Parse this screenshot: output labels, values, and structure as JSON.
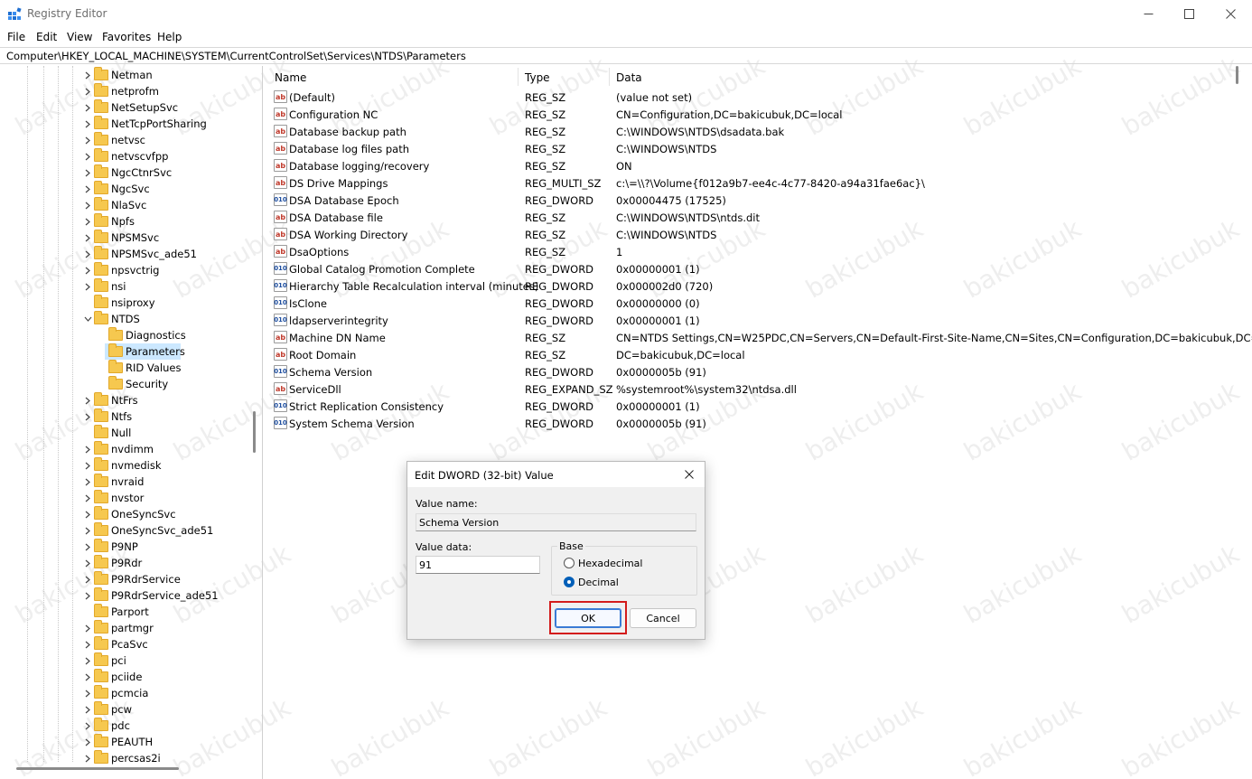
{
  "window": {
    "title": "Registry Editor"
  },
  "menu": [
    "File",
    "Edit",
    "View",
    "Favorites",
    "Help"
  ],
  "address": "Computer\\HKEY_LOCAL_MACHINE\\SYSTEM\\CurrentControlSet\\Services\\NTDS\\Parameters",
  "tree": {
    "items": [
      {
        "label": "Netman",
        "expandable": true
      },
      {
        "label": "netprofm",
        "expandable": true
      },
      {
        "label": "NetSetupSvc",
        "expandable": true
      },
      {
        "label": "NetTcpPortSharing",
        "expandable": true
      },
      {
        "label": "netvsc",
        "expandable": true
      },
      {
        "label": "netvscvfpp",
        "expandable": true
      },
      {
        "label": "NgcCtnrSvc",
        "expandable": true
      },
      {
        "label": "NgcSvc",
        "expandable": true
      },
      {
        "label": "NlaSvc",
        "expandable": true
      },
      {
        "label": "Npfs",
        "expandable": true
      },
      {
        "label": "NPSMSvc",
        "expandable": true
      },
      {
        "label": "NPSMSvc_ade51",
        "expandable": true
      },
      {
        "label": "npsvctrig",
        "expandable": true
      },
      {
        "label": "nsi",
        "expandable": true
      },
      {
        "label": "nsiproxy",
        "expandable": false
      },
      {
        "label": "NTDS",
        "expandable": true,
        "expanded": true
      },
      {
        "label": "Diagnostics",
        "child": true
      },
      {
        "label": "Parameters",
        "child": true,
        "selected": true
      },
      {
        "label": "RID Values",
        "child": true
      },
      {
        "label": "Security",
        "child": true
      },
      {
        "label": "NtFrs",
        "expandable": true
      },
      {
        "label": "Ntfs",
        "expandable": true
      },
      {
        "label": "Null",
        "expandable": false
      },
      {
        "label": "nvdimm",
        "expandable": true
      },
      {
        "label": "nvmedisk",
        "expandable": true
      },
      {
        "label": "nvraid",
        "expandable": true
      },
      {
        "label": "nvstor",
        "expandable": true
      },
      {
        "label": "OneSyncSvc",
        "expandable": true
      },
      {
        "label": "OneSyncSvc_ade51",
        "expandable": true
      },
      {
        "label": "P9NP",
        "expandable": true
      },
      {
        "label": "P9Rdr",
        "expandable": true
      },
      {
        "label": "P9RdrService",
        "expandable": true
      },
      {
        "label": "P9RdrService_ade51",
        "expandable": true
      },
      {
        "label": "Parport",
        "expandable": false
      },
      {
        "label": "partmgr",
        "expandable": true
      },
      {
        "label": "PcaSvc",
        "expandable": true
      },
      {
        "label": "pci",
        "expandable": true
      },
      {
        "label": "pciide",
        "expandable": true
      },
      {
        "label": "pcmcia",
        "expandable": true
      },
      {
        "label": "pcw",
        "expandable": true
      },
      {
        "label": "pdc",
        "expandable": true
      },
      {
        "label": "PEAUTH",
        "expandable": true
      },
      {
        "label": "percsas2i",
        "expandable": true
      }
    ]
  },
  "list": {
    "columns": [
      "Name",
      "Type",
      "Data"
    ],
    "rows": [
      {
        "name": "(Default)",
        "type": "REG_SZ",
        "data": "(value not set)",
        "icon": "sz"
      },
      {
        "name": "Configuration NC",
        "type": "REG_SZ",
        "data": "CN=Configuration,DC=bakicubuk,DC=local",
        "icon": "sz"
      },
      {
        "name": "Database backup path",
        "type": "REG_SZ",
        "data": "C:\\WINDOWS\\NTDS\\dsadata.bak",
        "icon": "sz"
      },
      {
        "name": "Database log files path",
        "type": "REG_SZ",
        "data": "C:\\WINDOWS\\NTDS",
        "icon": "sz"
      },
      {
        "name": "Database logging/recovery",
        "type": "REG_SZ",
        "data": "ON",
        "icon": "sz"
      },
      {
        "name": "DS Drive Mappings",
        "type": "REG_MULTI_SZ",
        "data": "c:\\=\\\\?\\Volume{f012a9b7-ee4c-4c77-8420-a94a31fae6ac}\\",
        "icon": "sz"
      },
      {
        "name": "DSA Database Epoch",
        "type": "REG_DWORD",
        "data": "0x00004475 (17525)",
        "icon": "bin"
      },
      {
        "name": "DSA Database file",
        "type": "REG_SZ",
        "data": "C:\\WINDOWS\\NTDS\\ntds.dit",
        "icon": "sz"
      },
      {
        "name": "DSA Working Directory",
        "type": "REG_SZ",
        "data": "C:\\WINDOWS\\NTDS",
        "icon": "sz"
      },
      {
        "name": "DsaOptions",
        "type": "REG_SZ",
        "data": "1",
        "icon": "sz"
      },
      {
        "name": "Global Catalog Promotion Complete",
        "type": "REG_DWORD",
        "data": "0x00000001 (1)",
        "icon": "bin"
      },
      {
        "name": "Hierarchy Table Recalculation interval (minutes)",
        "type": "REG_DWORD",
        "data": "0x000002d0 (720)",
        "icon": "bin"
      },
      {
        "name": "IsClone",
        "type": "REG_DWORD",
        "data": "0x00000000 (0)",
        "icon": "bin"
      },
      {
        "name": "ldapserverintegrity",
        "type": "REG_DWORD",
        "data": "0x00000001 (1)",
        "icon": "bin"
      },
      {
        "name": "Machine DN Name",
        "type": "REG_SZ",
        "data": "CN=NTDS Settings,CN=W25PDC,CN=Servers,CN=Default-First-Site-Name,CN=Sites,CN=Configuration,DC=bakicubuk,DC=local",
        "icon": "sz"
      },
      {
        "name": "Root Domain",
        "type": "REG_SZ",
        "data": "DC=bakicubuk,DC=local",
        "icon": "sz"
      },
      {
        "name": "Schema Version",
        "type": "REG_DWORD",
        "data": "0x0000005b (91)",
        "icon": "bin"
      },
      {
        "name": "ServiceDll",
        "type": "REG_EXPAND_SZ",
        "data": "%systemroot%\\system32\\ntdsa.dll",
        "icon": "sz"
      },
      {
        "name": "Strict Replication Consistency",
        "type": "REG_DWORD",
        "data": "0x00000001 (1)",
        "icon": "bin"
      },
      {
        "name": "System Schema Version",
        "type": "REG_DWORD",
        "data": "0x0000005b (91)",
        "icon": "bin"
      }
    ]
  },
  "dialog": {
    "title": "Edit DWORD (32-bit) Value",
    "value_name_label": "Value name:",
    "value_name": "Schema Version",
    "value_data_label": "Value data:",
    "value_data": "91",
    "base_label": "Base",
    "hex_label": "Hexadecimal",
    "dec_label": "Decimal",
    "selected_base": "Decimal",
    "ok_label": "OK",
    "cancel_label": "Cancel"
  },
  "watermark": "bakicubuk",
  "icons": {
    "close": "close-icon",
    "minimize": "minimize-icon",
    "maximize": "maximize-icon",
    "string_value": "string-value-icon",
    "binary_value": "binary-value-icon",
    "folder": "folder-icon",
    "chevron_right": "chevron-right-icon",
    "chevron_down": "chevron-down-icon"
  },
  "colors": {
    "selection": "#cce8ff",
    "folder": "#f6c84f",
    "highlight": "#d31c1c",
    "radio_checked": "#005fb8"
  }
}
